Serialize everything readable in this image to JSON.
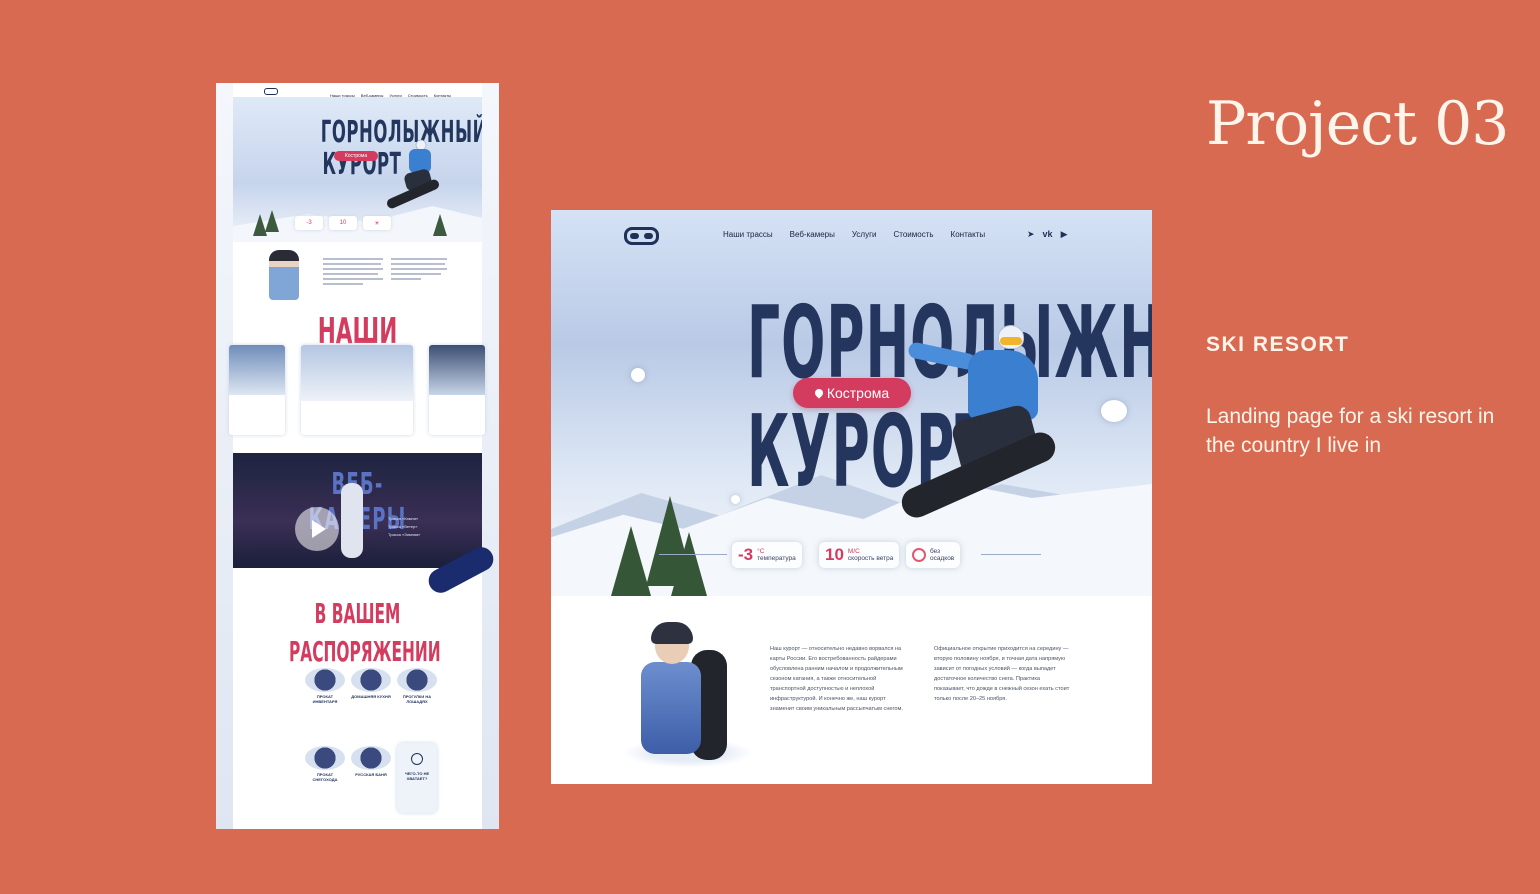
{
  "header": {
    "project_title": "Project 03",
    "subtitle": "SKI RESORT",
    "description": "Landing page for a ski resort in the country I live in"
  },
  "site": {
    "nav": [
      "Наши трассы",
      "Веб-камеры",
      "Услуги",
      "Стоимость",
      "Контакты"
    ],
    "socials": [
      "telegram-icon",
      "vk-icon",
      "youtube-icon"
    ],
    "hero_title_line1": "ГОРНОЛЫЖНЫЙ",
    "hero_title_line2": "КУРОРТ",
    "location": "Кострома",
    "weather": {
      "temp_value": "-3",
      "temp_unit": "°С",
      "temp_label": "температура",
      "wind_value": "10",
      "wind_unit": "М/С",
      "wind_label": "скорость ветра",
      "precip_label_1": "без",
      "precip_label_2": "осадков"
    },
    "about_left": "Наш курорт — относительно недавно ворвался на карты России. Его востребованность райдерами обусловлена ранним началом и продолжительным сезоном катания, а также относительной транспортной доступностью и неплохой инфраструктурой. И конечно же, наш курорт знаменит своим уникальным рассыпчатым снегом.",
    "about_right": "Официальное открытие приходится на середину — вторую половину ноября, и точная дата напрямую зависит от погодных условий — когда выпадет достаточное количество снега. Практика показывает, что дожде в снежный сезон ехать стоит только после 20–25 ноября."
  },
  "long_preview": {
    "section_trails": "НАШИ ТРАССЫ",
    "section_webcams": "ВЕБ-КАМЕРЫ",
    "section_services": "В ВАШЕМ РАСПОРЯЖЕНИИ",
    "services": [
      "ПРОКАТ ИНВЕНТАРЯ",
      "ДОМАШНЯЯ КУХНЯ",
      "ПРОГУЛКИ НА ЛОШАДЯХ",
      "ПРОКАТ СНЕГОХОДА",
      "РУССКАЯ БАНЯ",
      "ЧЕГО-ТО НЕ ХВАТАЕТ?"
    ],
    "webcam_list": [
      "Трасса «Камни»",
      "Трасса «Ветер»",
      "Трасса «Зимняя»"
    ]
  },
  "colors": {
    "background": "#d86a52",
    "accent": "#d43c5f",
    "navy": "#25365e"
  }
}
